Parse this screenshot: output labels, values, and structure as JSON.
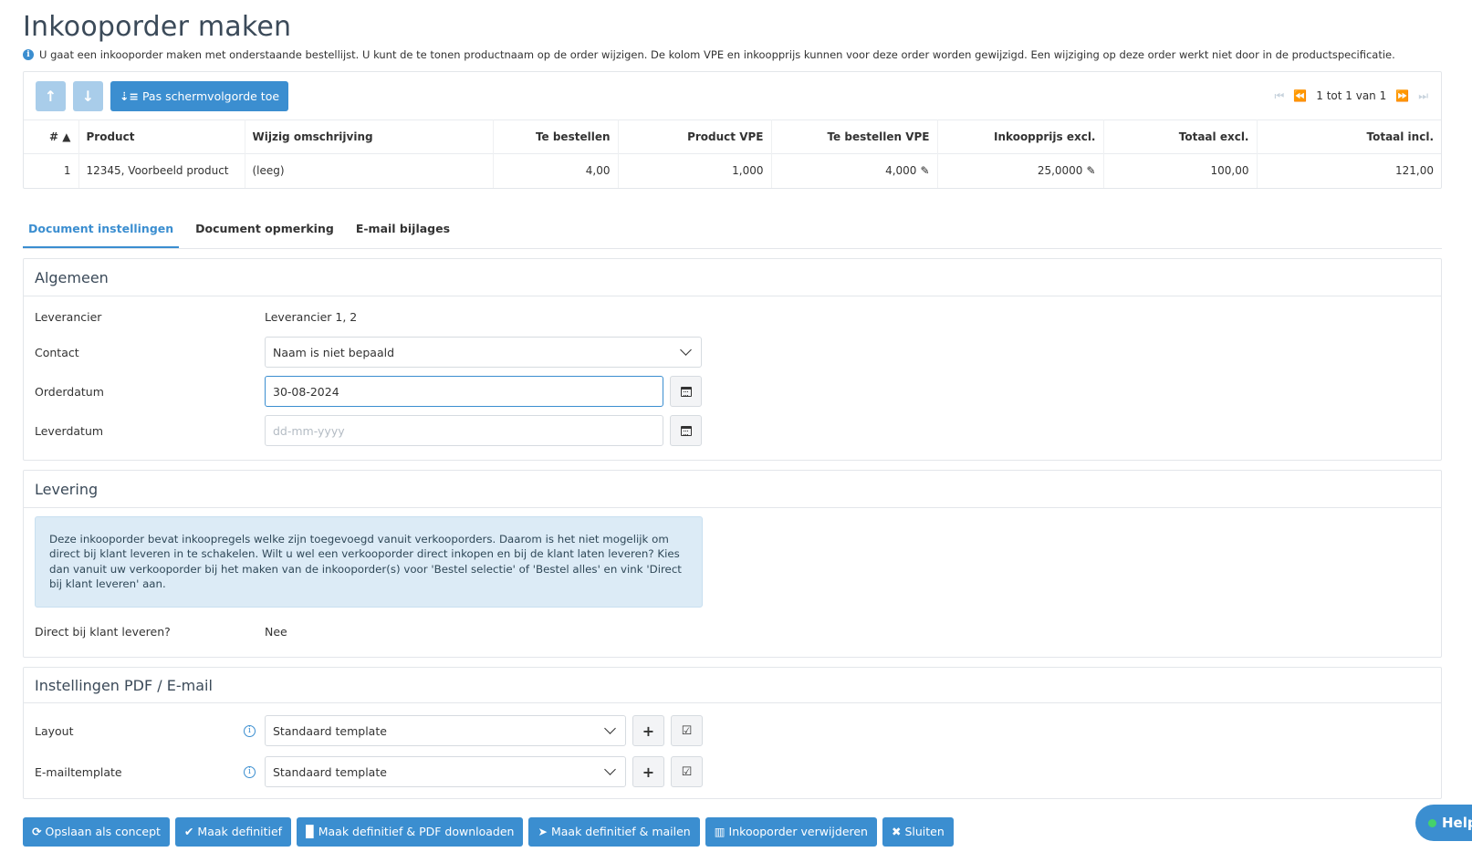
{
  "page": {
    "title": "Inkooporder maken",
    "info": "U gaat een inkooporder maken met onderstaande bestellijst. U kunt de te tonen productnaam op de order wijzigen. De kolom VPE en inkoopprijs kunnen voor deze order worden gewijzigd. Een wijziging op deze order werkt niet door in de productspecificatie."
  },
  "toolbar": {
    "move_up_icon": "↑",
    "move_down_icon": "↓",
    "apply_order_label": "Pas schermvolgorde toe",
    "pager_text": "1 tot 1 van 1"
  },
  "table": {
    "headers": {
      "nr": "# ▲",
      "product": "Product",
      "description": "Wijzig omschrijving",
      "to_order": "Te bestellen",
      "product_vpe": "Product VPE",
      "to_order_vpe": "Te bestellen VPE",
      "purchase_price": "Inkoopprijs excl.",
      "total_excl": "Totaal excl.",
      "total_incl": "Totaal incl."
    },
    "rows": [
      {
        "nr": "1",
        "product": "12345, Voorbeeld product",
        "description": "(leeg)",
        "to_order": "4,00",
        "product_vpe": "1,000",
        "to_order_vpe": "4,000",
        "purchase_price": "25,0000",
        "total_excl": "100,00",
        "total_incl": "121,00"
      }
    ]
  },
  "tabs": [
    "Document instellingen",
    "Document opmerking",
    "E-mail bijlages"
  ],
  "general": {
    "heading": "Algemeen",
    "supplier_label": "Leverancier",
    "supplier_value": "Leverancier 1, 2",
    "contact_label": "Contact",
    "contact_value": "Naam is niet bepaald",
    "order_date_label": "Orderdatum",
    "order_date_value": "30-08-2024",
    "delivery_date_label": "Leverdatum",
    "delivery_date_placeholder": "dd-mm-yyyy"
  },
  "delivery": {
    "heading": "Levering",
    "alert": "Deze inkooporder bevat inkoopregels welke zijn toegevoegd vanuit verkooporders. Daarom is het niet mogelijk om direct bij klant leveren in te schakelen. Wilt u wel een verkooporder direct inkopen en bij de klant laten leveren? Kies dan vanuit uw verkooporder bij het maken van de inkooporder(s) voor 'Bestel selectie' of 'Bestel alles' en vink 'Direct bij klant leveren' aan.",
    "direct_label": "Direct bij klant leveren?",
    "direct_value": "Nee"
  },
  "pdf_email": {
    "heading": "Instellingen PDF / E-mail",
    "layout_label": "Layout",
    "layout_value": "Standaard template",
    "email_template_label": "E-mailtemplate",
    "email_template_value": "Standaard template"
  },
  "footer": {
    "save_concept": "Opslaan als concept",
    "make_final": "Maak definitief",
    "make_final_pdf": "Maak definitief & PDF downloaden",
    "make_final_mail": "Maak definitief & mailen",
    "delete_order": "Inkooporder verwijderen",
    "close": "Sluiten"
  },
  "help": {
    "label": "Help"
  },
  "colors": {
    "primary": "#3b8ed0",
    "primary_light": "#a9cdea",
    "alert_bg": "#dcebf6",
    "online_dot": "#45d26b"
  }
}
